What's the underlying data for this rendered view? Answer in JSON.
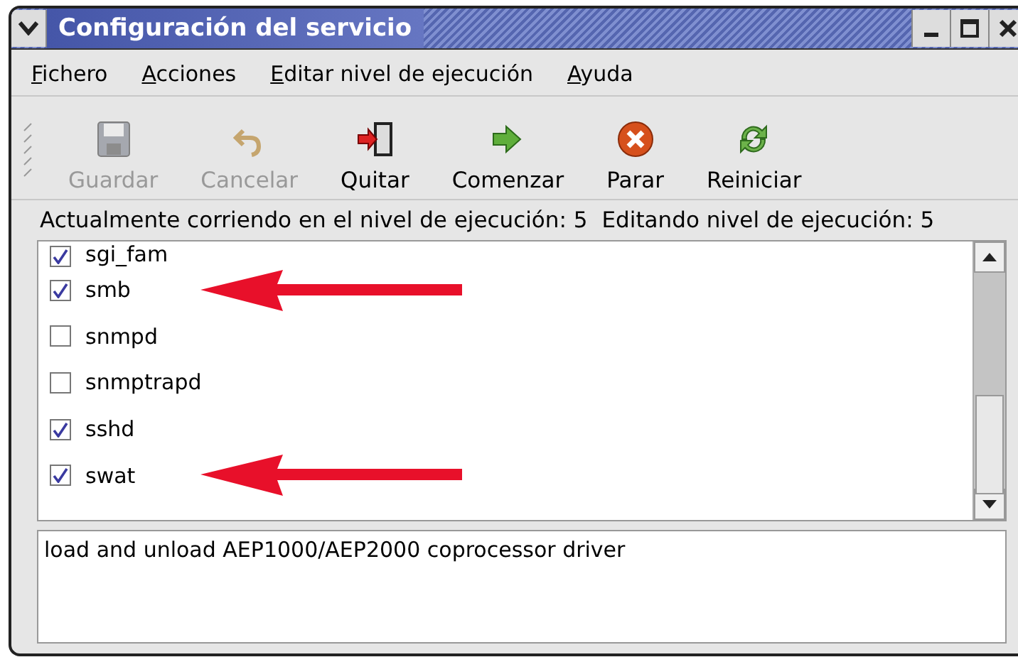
{
  "window": {
    "title": "Configuración del servicio"
  },
  "menu": [
    "Fichero",
    "Acciones",
    "Editar nivel de ejecución",
    "Ayuda"
  ],
  "toolbar": [
    {
      "kind": "save",
      "label": "Guardar",
      "disabled": true
    },
    {
      "kind": "undo",
      "label": "Cancelar",
      "disabled": true
    },
    {
      "kind": "quit",
      "label": "Quitar",
      "disabled": false
    },
    {
      "kind": "start",
      "label": "Comenzar",
      "disabled": false
    },
    {
      "kind": "stop",
      "label": "Parar",
      "disabled": false
    },
    {
      "kind": "restart",
      "label": "Reiniciar",
      "disabled": false
    }
  ],
  "status_bar": {
    "current": "Actualmente corriendo en el nivel de ejecución: 5",
    "editing": "Editando nivel de ejecución: 5"
  },
  "services": [
    {
      "name": "sgi_fam",
      "checked": true,
      "pointer_arrow": false
    },
    {
      "name": "smb",
      "checked": true,
      "pointer_arrow": true
    },
    {
      "name": "snmpd",
      "checked": false,
      "pointer_arrow": false
    },
    {
      "name": "snmptrapd",
      "checked": false,
      "pointer_arrow": false
    },
    {
      "name": "sshd",
      "checked": true,
      "pointer_arrow": false
    },
    {
      "name": "swat",
      "checked": true,
      "pointer_arrow": true
    }
  ],
  "description": "load and unload AEP1000/AEP2000 coprocessor driver"
}
